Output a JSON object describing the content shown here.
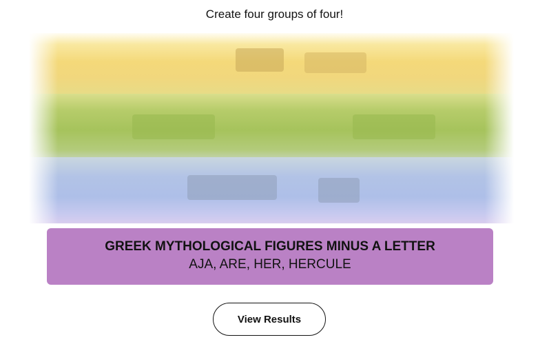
{
  "instructions": "Create four groups of four!",
  "board": {
    "hidden_group_colors": [
      "#f4d97a",
      "#a6c35c",
      "#aebfe8"
    ]
  },
  "solved_group": {
    "color": "#ba81c5",
    "title": "GREEK MYTHOLOGICAL FIGURES MINUS A LETTER",
    "members": "AJA, ARE, HER, HERCULE"
  },
  "actions": {
    "view_results_label": "View Results"
  }
}
